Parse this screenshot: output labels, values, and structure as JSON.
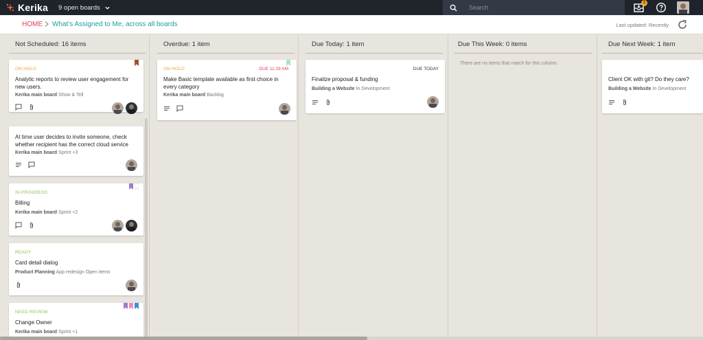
{
  "app": {
    "name": "Kerika",
    "boards_label": "9 open boards"
  },
  "search": {
    "placeholder": "Search"
  },
  "notifications": {
    "count": "1"
  },
  "breadcrumb": {
    "home": "HOME",
    "title": "What's Assigned to Me, across all boards"
  },
  "last_updated": "Last updated: Recently",
  "colors": {
    "accent": "#e23d57",
    "teal": "#1aa0a0",
    "onhold": "#e8a33a",
    "inprogress": "#8cc152",
    "due_red": "#e23d57"
  },
  "columns": [
    {
      "header": "Not Scheduled: 16 items",
      "cards": [
        {
          "status": "ON HOLD",
          "title": "Analytic reports to review user engagement for new users.",
          "board": "Kerika main board",
          "list": "Show & Tell"
        },
        {
          "status": "",
          "title": "At time user decides to invite someone, check whether recipient has the correct cloud service",
          "board": "Kerika main board",
          "list": "Sprint +3"
        },
        {
          "status": "IN PROGRESS",
          "title": "Billing",
          "board": "Kerika main board",
          "list": "Sprint +2"
        },
        {
          "status": "READY",
          "title": "Card detail dialog",
          "board": "Product Planning",
          "list": "App redesign Open items"
        },
        {
          "status": "NEED REVIEW",
          "title": "Change Owner",
          "board": "Kerika main board",
          "list": "Sprint +1"
        }
      ]
    },
    {
      "header": "Overdue: 1 item",
      "cards": [
        {
          "status": "ON HOLD",
          "due": "DUE 11:29 AM",
          "title": "Make Basic template available as first choice in every category",
          "board": "Kerika main board",
          "list": "Backlog"
        }
      ]
    },
    {
      "header": "Due Today: 1 item",
      "cards": [
        {
          "due": "DUE TODAY",
          "title": "Finalize proposal & funding",
          "board": "Building a Website",
          "list": "In Development"
        }
      ]
    },
    {
      "header": "Due This Week: 0 items",
      "empty": "There are no items that match for this column."
    },
    {
      "header": "Due Next Week: 1 item",
      "cards": [
        {
          "title": "Client OK with git? Do they care?",
          "board": "Building a Website",
          "list": "In Development"
        }
      ]
    }
  ]
}
